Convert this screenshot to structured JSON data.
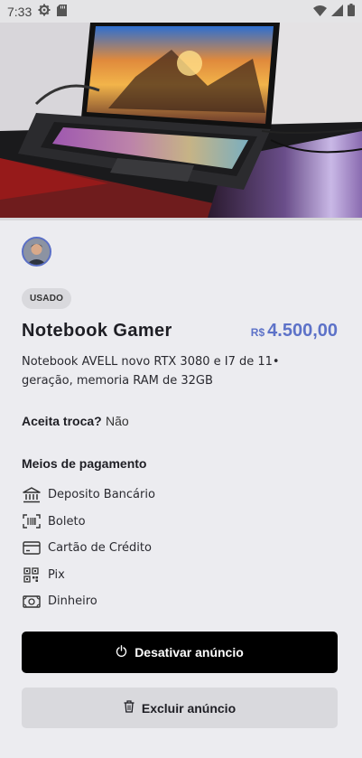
{
  "status_bar": {
    "time": "7:33"
  },
  "ad": {
    "condition_badge": "USADO",
    "title": "Notebook Gamer",
    "price_currency": "R$",
    "price_value": "4.500,00",
    "description": "Notebook AVELL novo RTX 3080 e I7 de 11• geração, memoria RAM de 32GB",
    "trade_label": "Aceita troca?",
    "trade_value": "Não"
  },
  "payments": {
    "title": "Meios de pagamento",
    "items": [
      {
        "label": "Deposito Bancário",
        "icon": "bank-icon"
      },
      {
        "label": "Boleto",
        "icon": "barcode-icon"
      },
      {
        "label": "Cartão de Crédito",
        "icon": "credit-card-icon"
      },
      {
        "label": "Pix",
        "icon": "qr-code-icon"
      },
      {
        "label": "Dinheiro",
        "icon": "money-icon"
      }
    ]
  },
  "actions": {
    "deactivate_label": "Desativar anúncio",
    "delete_label": "Excluir anúncio"
  },
  "colors": {
    "accent": "#5D72C8",
    "background": "#ECECF0",
    "primary_button": "#000000",
    "secondary_button": "#D9D9DD"
  }
}
